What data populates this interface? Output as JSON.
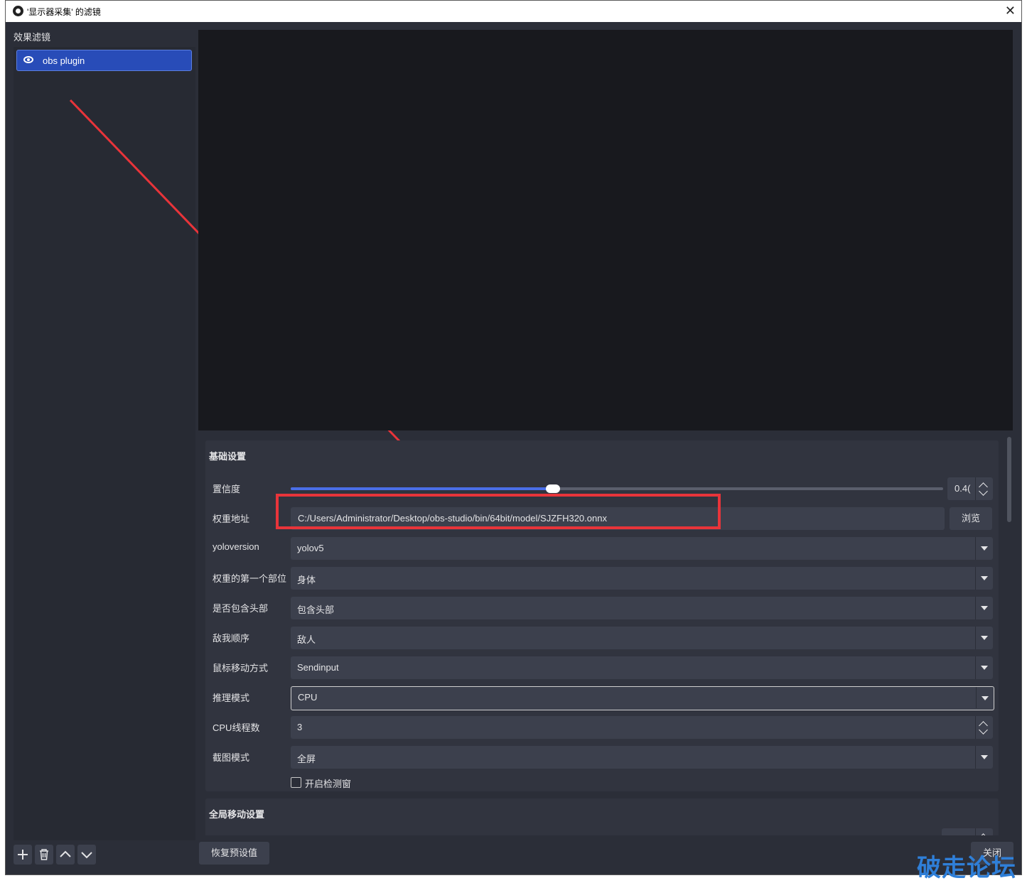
{
  "window": {
    "title": "'显示器采集' 的滤镜",
    "close_label": "✕"
  },
  "filters": {
    "panel_title": "效果滤镜",
    "items": [
      {
        "label": "obs plugin"
      }
    ]
  },
  "basic": {
    "title": "基础设置",
    "confidence": {
      "label": "置信度",
      "value": "0.4(",
      "fraction": 0.402
    },
    "weights": {
      "label": "权重地址",
      "value": "C:/Users/Administrator/Desktop/obs-studio/bin/64bit/model/SJZFH320.onnx",
      "browse": "浏览"
    },
    "yoloversion": {
      "label": "yoloversion",
      "value": "yolov5"
    },
    "first_part": {
      "label": "权重的第一个部位",
      "value": "身体"
    },
    "include_head": {
      "label": "是否包含头部",
      "value": "包含头部"
    },
    "order": {
      "label": "敌我顺序",
      "value": "敌人"
    },
    "mouse_mode": {
      "label": "鼠标移动方式",
      "value": "Sendinput"
    },
    "infer_mode": {
      "label": "推理模式",
      "value": "CPU"
    },
    "cpu_threads": {
      "label": "CPU线程数",
      "value": "3"
    },
    "capture_mode": {
      "label": "截图模式",
      "value": "全屏"
    },
    "detect_window": {
      "label": "开启检测窗"
    }
  },
  "global": {
    "title": "全局移动设置"
  },
  "footer": {
    "reset": "恢复预设值",
    "close": "关闭"
  },
  "watermark": "破走论坛"
}
